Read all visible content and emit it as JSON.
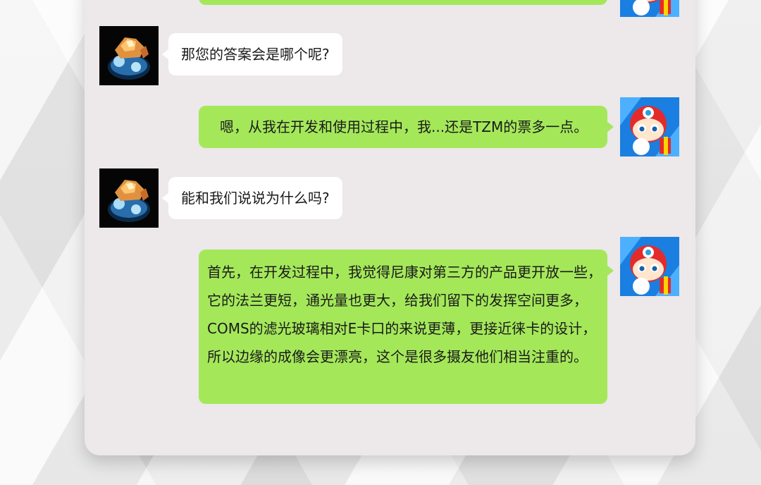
{
  "colors": {
    "panel_background": "#ede8ea",
    "incoming_bubble": "#ffffff",
    "outgoing_bubble": "#a4e85a"
  },
  "messages": [
    {
      "direction": "outgoing",
      "text": "",
      "avatar": "robot-hero-avatar-icon"
    },
    {
      "direction": "incoming",
      "text": "那您的答案会是哪个呢?",
      "avatar": "glowing-rock-avatar-icon"
    },
    {
      "direction": "outgoing",
      "text": "嗯，从我在开发和使用过程中，我...还是TZM的票多一点。",
      "avatar": "robot-hero-avatar-icon"
    },
    {
      "direction": "incoming",
      "text": "能和我们说说为什么吗?",
      "avatar": "glowing-rock-avatar-icon"
    },
    {
      "direction": "outgoing",
      "text": "首先，在开发过程中，我觉得尼康对第三方的产品更开放一些，它的法兰更短，通光量也更大，给我们留下的发挥空间更多，COMS的滤光玻璃相对E卡口的来说更薄，更接近徕卡的设计，所以边缘的成像会更漂亮，这个是很多摄友他们相当注重的。",
      "avatar": "robot-hero-avatar-icon"
    }
  ]
}
